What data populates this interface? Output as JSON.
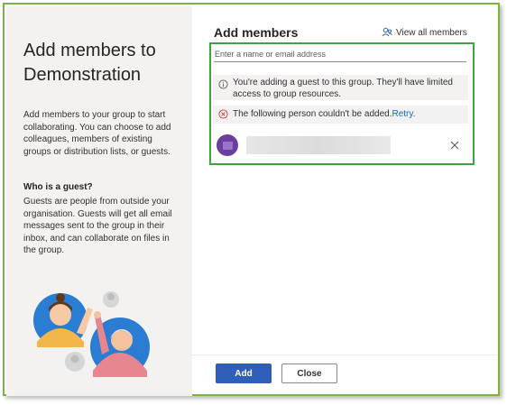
{
  "dialog": {
    "title": "Add members to Demonstration",
    "description": "Add members to your group to start collaborating. You can choose to add colleagues, members of existing groups or distribution lists, or guests.",
    "guest_heading": "Who is a guest?",
    "guest_text": "Guests are people from outside your organisation. Guests will get all email messages sent to the group in their inbox, and can collaborate on files in the group."
  },
  "panel": {
    "title": "Add members",
    "view_all_label": "View all members",
    "search_placeholder": "Enter a name or email address",
    "info_message": "You're adding a guest to this group. They'll have limited access to group resources.",
    "error_message": "The following person couldn't be added.",
    "retry_label": "Retry.",
    "icons": {
      "view_all": "people-icon",
      "info": "info-icon",
      "error": "error-circle-icon",
      "remove": "close-icon"
    }
  },
  "footer": {
    "add_label": "Add",
    "close_label": "Close"
  },
  "colors": {
    "accent": "#2e5eb8",
    "highlight_border": "#43a047",
    "error": "#d13438",
    "avatar": "#6b3fa0"
  }
}
